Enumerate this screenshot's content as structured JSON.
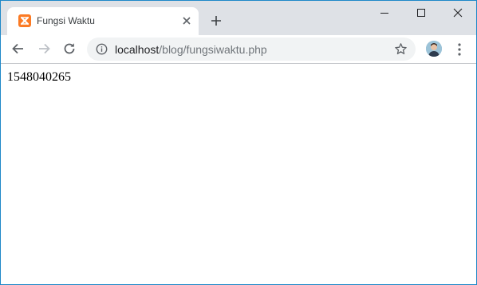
{
  "window": {
    "controls": [
      "minimize-icon",
      "maximize-icon",
      "close-icon"
    ]
  },
  "tab": {
    "title": "Fungsi Waktu",
    "favicon": "xampp-icon",
    "favicon_color": "#fb7a24"
  },
  "toolbar": {
    "url_host": "localhost",
    "url_path": "/blog/fungsiwaktu.php",
    "icons": [
      "back-arrow-icon",
      "forward-arrow-icon",
      "reload-icon",
      "info-icon",
      "star-icon",
      "profile-avatar",
      "menu-dots-icon"
    ]
  },
  "page": {
    "output": "1548040265"
  },
  "colors": {
    "tabstrip": "#dee1e6",
    "omnibox": "#f1f3f4",
    "window_border": "#1e88c8"
  }
}
